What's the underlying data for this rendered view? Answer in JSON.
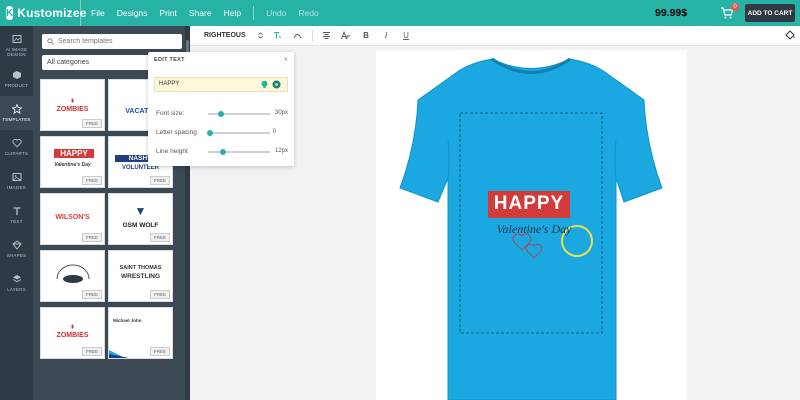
{
  "app": {
    "logo": "Kustomizee"
  },
  "menu": [
    "File",
    "Designs",
    "Print",
    "Share",
    "Help"
  ],
  "menu_dim": [
    "Undo",
    "Redo"
  ],
  "header": {
    "price": "99.99$",
    "cart_count": "0",
    "add_to_cart": "ADD TO CART"
  },
  "rail": [
    {
      "label": "AI IMAGE DESIGN"
    },
    {
      "label": "PRODUCT"
    },
    {
      "label": "TEMPLATES"
    },
    {
      "label": "CLIPARTS"
    },
    {
      "label": "IMAGES"
    },
    {
      "label": "TEXT"
    },
    {
      "label": "SHAPES"
    },
    {
      "label": "LAYERS"
    }
  ],
  "panel": {
    "search_placeholder": "Search templates",
    "category": "All categories"
  },
  "templates": [
    {
      "text": "ZOMBIES",
      "badge": "FREE"
    },
    {
      "text": "VACATIO",
      "badge": "FREE"
    },
    {
      "text": "HAPPY",
      "badge": "FREE"
    },
    {
      "text": "NASHVI",
      "badge": "FREE"
    },
    {
      "text": "WILSON'S",
      "badge": "FREE"
    },
    {
      "text": "GSM WOLF",
      "badge": "FREE"
    },
    {
      "text": "",
      "badge": "FREE"
    },
    {
      "text": "SAINT THOMAS",
      "badge": "FREE"
    },
    {
      "text": "ZOMBIES",
      "badge": "FREE"
    },
    {
      "text": "Michael John",
      "badge": "FREE"
    }
  ],
  "toolbar": {
    "font": "RIGHTEOUS"
  },
  "edit_text": {
    "title": "EDIT TEXT",
    "value": "HAPPY",
    "font_size_label": "Font size:",
    "font_size_value": "30px",
    "letter_spacing_label": "Letter spacing",
    "letter_spacing_value": "0",
    "line_height_label": "Line height",
    "line_height_value": "12px"
  },
  "design": {
    "headline": "HAPPY",
    "subline": "Valentine's Day"
  },
  "colors": {
    "accent": "#26b3a6",
    "tshirt": "#1ba7e0",
    "banner": "#d33b3b",
    "dark": "#2f3a45"
  }
}
